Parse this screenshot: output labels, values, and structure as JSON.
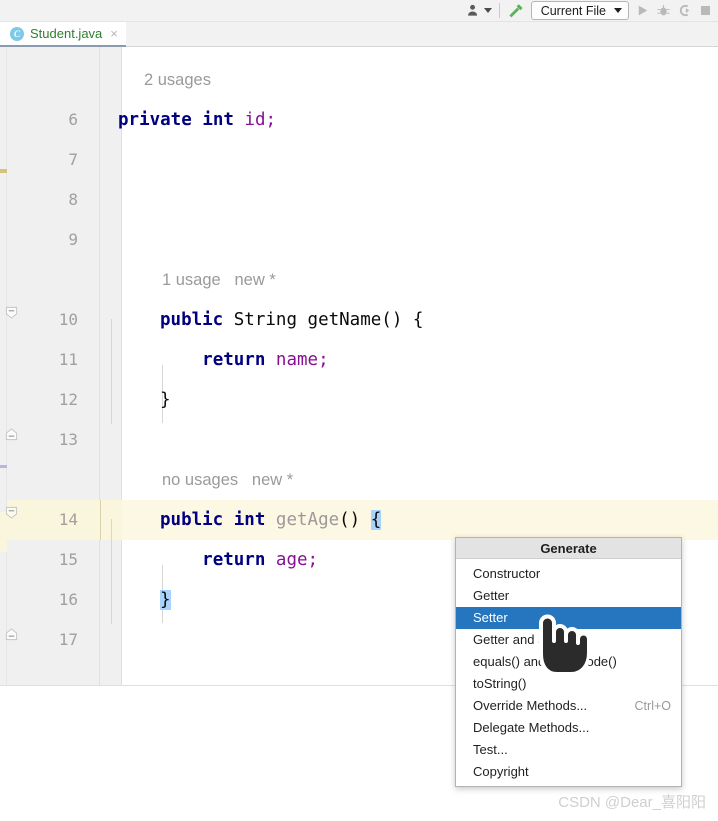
{
  "toolbar": {
    "profile_icon": "person-icon",
    "build_icon": "hammer-build-icon",
    "run_config_label": "Current File",
    "run_icon": "run-play-icon",
    "debug_icon": "debug-bug-icon",
    "coverage_icon": "run-with-coverage-icon",
    "stop_icon": "stop-square-icon"
  },
  "tab": {
    "badge": "C",
    "label": "Student.java",
    "close": "×"
  },
  "editor": {
    "lines": [
      {
        "num": "",
        "hint": "2 usages",
        "code": "",
        "highlight": false
      },
      {
        "num": "6",
        "hint": "",
        "code": "private int id;",
        "highlight": false
      },
      {
        "num": "7",
        "hint": "",
        "code": "",
        "highlight": false
      },
      {
        "num": "8",
        "hint": "",
        "code": "",
        "highlight": false
      },
      {
        "num": "9",
        "hint": "",
        "code": "",
        "highlight": false
      },
      {
        "num": "",
        "hint": "1 usage   new *",
        "code": "",
        "highlight": false
      },
      {
        "num": "10",
        "hint": "",
        "code": "public String getName() {",
        "highlight": false
      },
      {
        "num": "11",
        "hint": "",
        "code": "    return name;",
        "highlight": false
      },
      {
        "num": "12",
        "hint": "",
        "code": "}",
        "highlight": false
      },
      {
        "num": "13",
        "hint": "",
        "code": "",
        "highlight": false
      },
      {
        "num": "",
        "hint": "no usages   new *",
        "code": "",
        "highlight": false
      },
      {
        "num": "14",
        "hint": "",
        "code": "public int getAge() {",
        "highlight": true
      },
      {
        "num": "15",
        "hint": "",
        "code": "    return age;",
        "highlight": false
      },
      {
        "num": "16",
        "hint": "",
        "code": "}",
        "highlight": false
      },
      {
        "num": "17",
        "hint": "",
        "code": "",
        "highlight": false
      }
    ],
    "tokens": {
      "kw_private": "private",
      "kw_public": "public",
      "kw_int": "int",
      "kw_return": "return",
      "type_String": "String",
      "field_id": "id",
      "field_name": "name",
      "field_age": "age",
      "method_getName": "getName",
      "method_getAge": "getAge",
      "brace_open": "{",
      "brace_close": "}",
      "parens": "()",
      "semi": ";"
    },
    "hints": {
      "usages_2": "2 usages",
      "usage_1": "1 usage",
      "usages_none": "no usages",
      "new_marker": "new *"
    }
  },
  "popup": {
    "title": "Generate",
    "items": [
      {
        "label": "Constructor",
        "shortcut": "",
        "selected": false
      },
      {
        "label": "Getter",
        "shortcut": "",
        "selected": false
      },
      {
        "label": "Setter",
        "shortcut": "",
        "selected": true
      },
      {
        "label": "Getter and Setter",
        "shortcut": "",
        "selected": false
      },
      {
        "label": "equals() and hashCode()",
        "shortcut": "",
        "selected": false
      },
      {
        "label": "toString()",
        "shortcut": "",
        "selected": false
      },
      {
        "label": "Override Methods...",
        "shortcut": "Ctrl+O",
        "selected": false
      },
      {
        "label": "Delegate Methods...",
        "shortcut": "",
        "selected": false
      },
      {
        "label": "Test...",
        "shortcut": "",
        "selected": false
      },
      {
        "label": "Copyright",
        "shortcut": "",
        "selected": false
      }
    ]
  },
  "watermark": {
    "text": "CSDN @Dear_喜阳阳"
  },
  "colors": {
    "keyword": "#000080",
    "field": "#871094",
    "selection": "#2675bf",
    "line_highlight": "#fdf8e3",
    "brace_match": "#a8d4fb",
    "tab_label": "#2e7d32",
    "hint": "#9a9a9a"
  }
}
